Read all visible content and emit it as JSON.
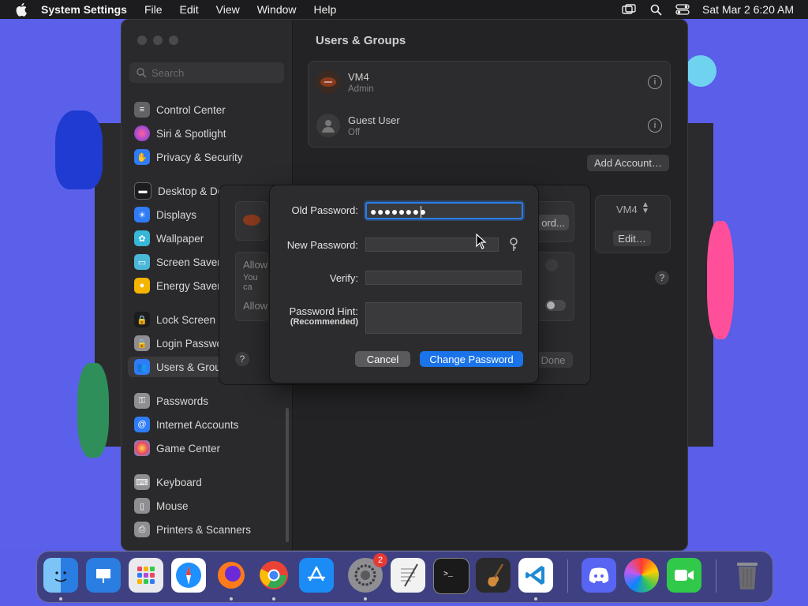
{
  "menubar": {
    "app_name": "System Settings",
    "menus": [
      "File",
      "Edit",
      "View",
      "Window",
      "Help"
    ],
    "datetime": "Sat Mar 2  6:20 AM"
  },
  "sidebar": {
    "search_placeholder": "Search",
    "items": [
      {
        "label": "Control Center",
        "icon": "control-center-icon",
        "color": "#636366"
      },
      {
        "label": "Siri & Spotlight",
        "icon": "siri-icon",
        "color": "#b04ad0"
      },
      {
        "label": "Privacy & Security",
        "icon": "hand-icon",
        "color": "#2f7cf6"
      },
      {
        "label": "Desktop & Dock",
        "icon": "dock-icon",
        "color": "#2b2b2d"
      },
      {
        "label": "Displays",
        "icon": "sun-icon",
        "color": "#2f7cf6"
      },
      {
        "label": "Wallpaper",
        "icon": "flower-icon",
        "color": "#38b6d8"
      },
      {
        "label": "Screen Saver",
        "icon": "screen-saver-icon",
        "color": "#4ab7d9"
      },
      {
        "label": "Energy Saver",
        "icon": "bulb-icon",
        "color": "#f4b400"
      },
      {
        "label": "Lock Screen",
        "icon": "lock-icon",
        "color": "#2b2b2d"
      },
      {
        "label": "Login Password",
        "icon": "lock-icon",
        "color": "#8e8e93"
      },
      {
        "label": "Users & Groups",
        "icon": "users-icon",
        "color": "#2f7cf6"
      },
      {
        "label": "Passwords",
        "icon": "key-icon",
        "color": "#8e8e93"
      },
      {
        "label": "Internet Accounts",
        "icon": "at-icon",
        "color": "#2f7cf6"
      },
      {
        "label": "Game Center",
        "icon": "game-center-icon",
        "color": "#e84a5f"
      },
      {
        "label": "Keyboard",
        "icon": "keyboard-icon",
        "color": "#8e8e93"
      },
      {
        "label": "Mouse",
        "icon": "mouse-icon",
        "color": "#8e8e93"
      },
      {
        "label": "Printers & Scanners",
        "icon": "printer-icon",
        "color": "#8e8e93"
      }
    ]
  },
  "content": {
    "title": "Users & Groups",
    "users": [
      {
        "name": "VM4",
        "role": "Admin"
      },
      {
        "name": "Guest User",
        "role": "Off"
      }
    ],
    "add_account": "Add Account…",
    "auto_login_value": "VM4",
    "edit_label": "Edit…"
  },
  "underlying_sheet": {
    "allow1": "Allow",
    "allow1_sub": "You ca",
    "allow2": "Allow",
    "right_button": "ord...",
    "done": "Done"
  },
  "dialog": {
    "old_password_label": "Old Password:",
    "old_password_value": "●●●●●●●●",
    "new_password_label": "New Password:",
    "verify_label": "Verify:",
    "hint_label": "Password Hint:",
    "hint_sub": "(Recommended)",
    "cancel": "Cancel",
    "confirm": "Change Password"
  },
  "dock": {
    "apps": [
      {
        "name": "Finder",
        "color": "#3a8ff0"
      },
      {
        "name": "Keynote",
        "color": "#2a7de1"
      },
      {
        "name": "Launchpad",
        "color": "#e9e9ee"
      },
      {
        "name": "Safari",
        "color": "#1e90ff"
      },
      {
        "name": "Firefox",
        "color": "#ff7a1a"
      },
      {
        "name": "Chrome",
        "color": "#ffffff"
      },
      {
        "name": "App Store",
        "color": "#1b8cf5"
      },
      {
        "name": "System Settings",
        "color": "#8e8e93",
        "badge": "2"
      },
      {
        "name": "TextEdit",
        "color": "#f2f2f2"
      },
      {
        "name": "Terminal",
        "color": "#1a1a1a"
      },
      {
        "name": "GarageBand",
        "color": "#2a2a2a"
      },
      {
        "name": "VS Code",
        "color": "#ffffff"
      },
      {
        "name": "Discord",
        "color": "#5865f2"
      },
      {
        "name": "Color Picker",
        "color": "#f0a030"
      },
      {
        "name": "FaceTime",
        "color": "#31c94a"
      },
      {
        "name": "Trash",
        "color": "#6c6c70"
      }
    ]
  }
}
